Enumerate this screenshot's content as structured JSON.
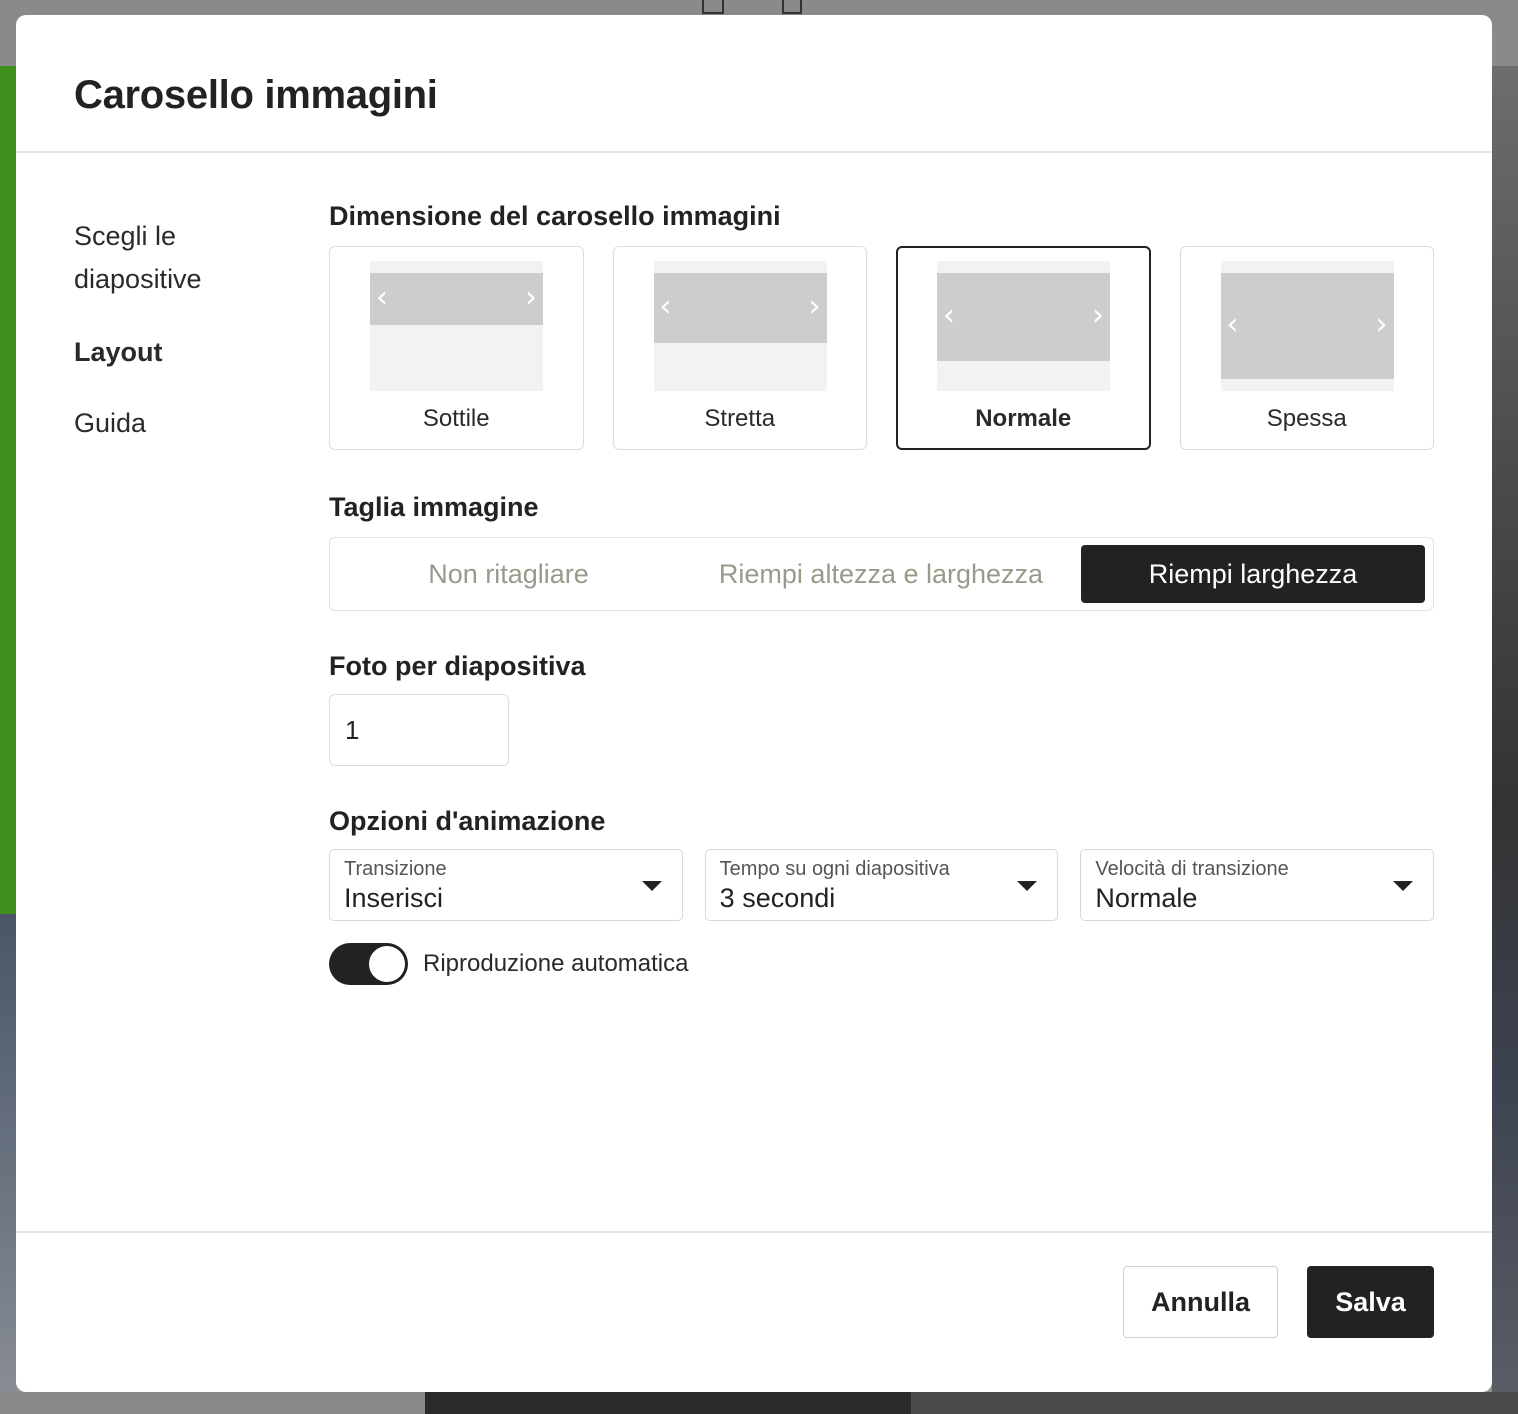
{
  "dialog": {
    "title": "Carosello immagini"
  },
  "sidebar": {
    "items": [
      {
        "label": "Scegli le diapositive"
      },
      {
        "label": "Layout"
      },
      {
        "label": "Guida"
      }
    ],
    "active": "Layout"
  },
  "carousel_size": {
    "title": "Dimensione del carosello immagini",
    "options": [
      {
        "label": "Sottile"
      },
      {
        "label": "Stretta"
      },
      {
        "label": "Normale"
      },
      {
        "label": "Spessa"
      }
    ],
    "selected": "Normale"
  },
  "image_crop": {
    "title": "Taglia immagine",
    "options": [
      {
        "label": "Non ritagliare"
      },
      {
        "label": "Riempi altezza e larghezza"
      },
      {
        "label": "Riempi larghezza"
      }
    ],
    "selected": "Riempi larghezza"
  },
  "photos_per_slide": {
    "title": "Foto per diapositiva",
    "value": "1"
  },
  "animation": {
    "title": "Opzioni d'animazione",
    "selects": [
      {
        "label": "Transizione",
        "value": "Inserisci"
      },
      {
        "label": "Tempo su ogni diapositiva",
        "value": "3 secondi"
      },
      {
        "label": "Velocità di transizione",
        "value": "Normale"
      }
    ],
    "autoplay": {
      "label": "Riproduzione automatica",
      "on": true
    }
  },
  "footer": {
    "cancel_label": "Annulla",
    "save_label": "Salva"
  }
}
